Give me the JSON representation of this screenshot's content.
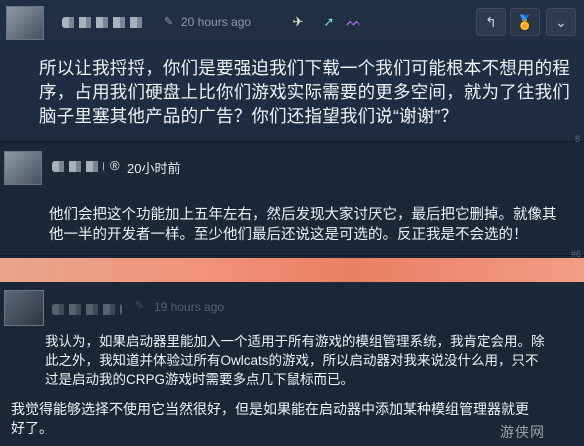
{
  "post1": {
    "timestamp": "20 hours ago",
    "awards": [
      "award-plane-icon",
      "award-rocket-icon",
      "award-cat-icon"
    ],
    "toolbar": {
      "reply_icon": "↰",
      "award_icon": "🏆",
      "collapse_icon": "»"
    },
    "body": "所以让我捋捋，你们是要强迫我们下载一个我们可能根本不想用的程序，占用我们硬盘上比你们游戏实际需要的更多空间，就为了往我们脑子里塞其他产品的广告？你们还指望我们说“谢谢”？",
    "tag": "8"
  },
  "post2": {
    "reg_mark": "®",
    "timestamp": "20小时前",
    "body": "他们会把这个功能加上五年左右，然后发现大家讨厌它，最后把它删掉。就像其他一半的开发者一样。至少他们最后还说这是可选的。反正我是不会选的！",
    "tag": "#6"
  },
  "post3": {
    "timestamp": "19 hours ago",
    "body": "我认为，如果启动器里能加入一个适用于所有游戏的模组管理系统，我肯定会用。除此之外，我知道并体验过所有Owlcats的游戏，所以启动器对我来说没什么用，只不过是启动我的CRPG游戏时需要多点几下鼠标而已。",
    "reply": "我觉得能够选择不使用它当然很好，但是如果能在启动器中添加某种模组管理器就更好了。"
  },
  "watermark": "游侠网"
}
